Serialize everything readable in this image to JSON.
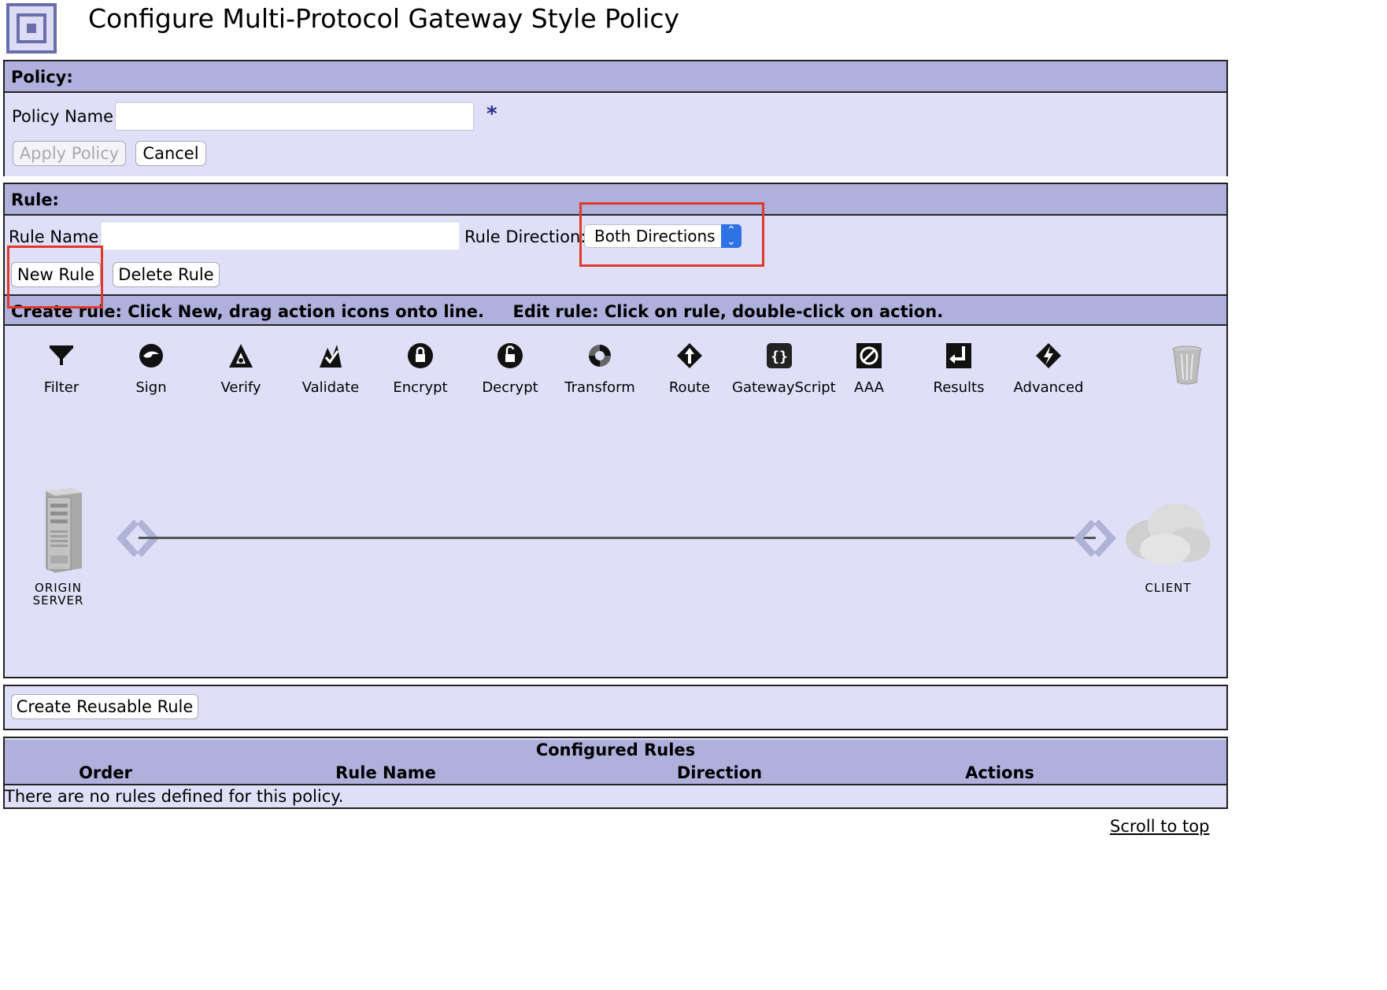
{
  "page": {
    "title": "Configure Multi-Protocol Gateway Style Policy"
  },
  "policy": {
    "header": "Policy:",
    "name_label": "Policy Name:",
    "name_value": "",
    "required_marker": "*",
    "apply_label": "Apply Policy",
    "cancel_label": "Cancel"
  },
  "rule": {
    "header": "Rule:",
    "name_label": "Rule Name:",
    "name_value": "",
    "direction_label": "Rule Direction:",
    "direction_value": "Both Directions",
    "new_label": "New Rule",
    "delete_label": "Delete Rule",
    "instructions": "Create rule: Click New, drag action icons onto line.     Edit rule: Click on rule, double-click on action."
  },
  "palette": [
    {
      "label": "Filter",
      "icon": "filter-icon"
    },
    {
      "label": "Sign",
      "icon": "sign-icon"
    },
    {
      "label": "Verify",
      "icon": "verify-icon"
    },
    {
      "label": "Validate",
      "icon": "validate-icon"
    },
    {
      "label": "Encrypt",
      "icon": "encrypt-icon"
    },
    {
      "label": "Decrypt",
      "icon": "decrypt-icon"
    },
    {
      "label": "Transform",
      "icon": "transform-icon"
    },
    {
      "label": "Route",
      "icon": "route-icon"
    },
    {
      "label": "GatewayScript",
      "icon": "gatewayscript-icon"
    },
    {
      "label": "AAA",
      "icon": "aaa-icon"
    },
    {
      "label": "Results",
      "icon": "results-icon"
    },
    {
      "label": "Advanced",
      "icon": "advanced-icon"
    }
  ],
  "canvas": {
    "origin_label_1": "ORIGIN",
    "origin_label_2": "SERVER",
    "client_label": "CLIENT"
  },
  "reusable": {
    "label": "Create Reusable Rule"
  },
  "configured": {
    "title": "Configured Rules",
    "columns": [
      "Order",
      "Rule Name",
      "Direction",
      "Actions"
    ],
    "empty_message": "There are no rules defined for this policy."
  },
  "footer": {
    "scroll_label": "Scroll to top"
  },
  "colors": {
    "panel": "#dfe0f8",
    "header": "#afb0dc",
    "highlight": "#e0392a",
    "select_accent": "#2f72e6"
  }
}
